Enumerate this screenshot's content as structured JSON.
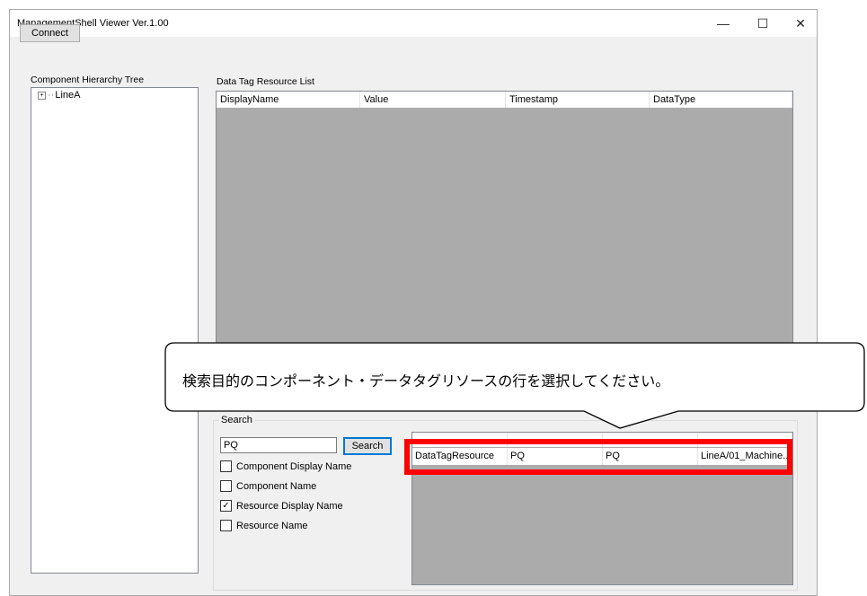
{
  "window": {
    "title": "ManagementShell Viewer Ver.1.00",
    "minimize_glyph": "—",
    "maximize_glyph": "☐",
    "close_glyph": "✕"
  },
  "toolbar": {
    "connect_label": "Connect"
  },
  "tree": {
    "label": "Component Hierarchy Tree",
    "nodes": [
      {
        "label": "LineA",
        "expander": "+"
      }
    ]
  },
  "tag_list": {
    "label": "Data Tag Resource List",
    "columns": [
      "DisplayName",
      "Value",
      "Timestamp",
      "DataType"
    ]
  },
  "search": {
    "group_label": "Search",
    "input_value": "PQ",
    "button_label": "Search",
    "options": [
      {
        "label": "Component Display Name",
        "checked": false
      },
      {
        "label": "Component Name",
        "checked": false
      },
      {
        "label": "Resource Display Name",
        "checked": true
      },
      {
        "label": "Resource Name",
        "checked": false
      }
    ],
    "results": {
      "rows": [
        [
          "DataTagResource",
          "PQ",
          "PQ",
          "LineA/01_Machine..."
        ]
      ]
    }
  },
  "callout": {
    "text": "検索目的のコンポーネント・データタグリソースの行を選択してください。",
    "highlight_color": "#ff0000"
  }
}
